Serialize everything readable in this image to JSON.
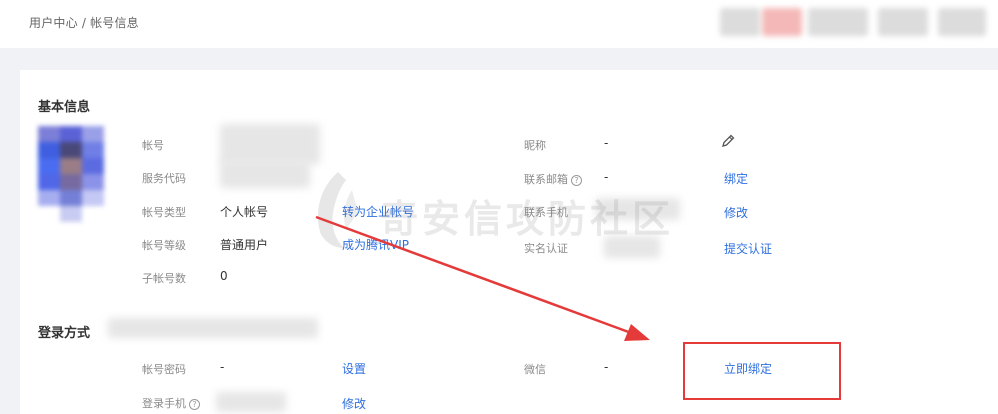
{
  "breadcrumb": "用户中心 / 帐号信息",
  "basic": {
    "title": "基本信息",
    "account_label": "帐号",
    "service_code_label": "服务代码",
    "account_type_label": "帐号类型",
    "account_type_value": "个人帐号",
    "account_type_link": "转为企业帐号",
    "account_level_label": "帐号等级",
    "account_level_value": "普通用户",
    "account_level_link": "成为腾讯VIP",
    "sub_accounts_label": "子帐号数",
    "sub_accounts_value": "0",
    "nickname_label": "昵称",
    "nickname_value": "-",
    "email_label": "联系邮箱",
    "email_value": "-",
    "email_link": "绑定",
    "phone_label": "联系手机",
    "phone_link": "修改",
    "realname_label": "实名认证",
    "realname_link": "提交认证"
  },
  "login": {
    "title": "登录方式",
    "password_label": "帐号密码",
    "password_value": "-",
    "password_link": "设置",
    "wechat_label": "微信",
    "wechat_value": "-",
    "wechat_link": "立即绑定",
    "login_phone_label": "登录手机",
    "login_phone_link": "修改"
  },
  "watermark": "奇安信攻防社区",
  "colors": {
    "link": "#2f6fe0",
    "annotation": "#e43a3a"
  }
}
